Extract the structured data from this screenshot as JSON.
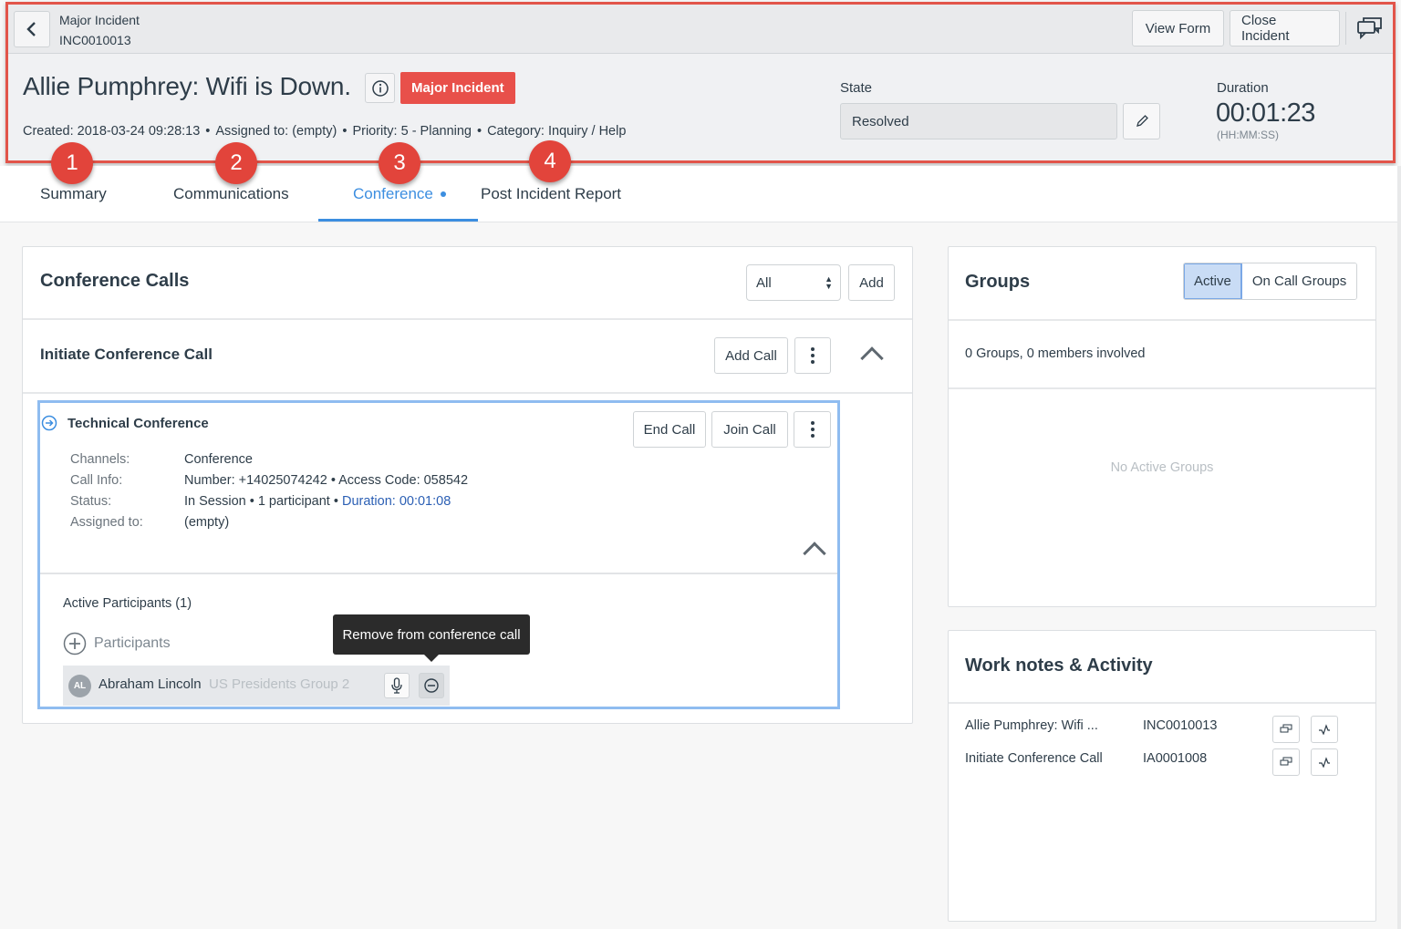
{
  "header": {
    "back_icon": "chevron-left-icon",
    "record_type": "Major Incident",
    "record_number": "INC0010013",
    "view_form_label": "View Form",
    "close_incident_label": "Close Incident",
    "chat_icon": "chat-bubbles-icon",
    "title": "Allie Pumphrey: Wifi is Down.",
    "info_icon": "info-circle-icon",
    "badge": "Major Incident",
    "meta": {
      "created": "Created: 2018-03-24 09:28:13",
      "assigned": "Assigned to: (empty)",
      "priority": "Priority: 5 - Planning",
      "category": "Category: Inquiry / Help",
      "separator": "•"
    },
    "state": {
      "label": "State",
      "value": "Resolved",
      "edit_icon": "pencil-icon"
    },
    "duration": {
      "label": "Duration",
      "value": "00:01:23",
      "unit": "(HH:MM:SS)"
    },
    "accent_color": "#e2554a"
  },
  "tabs": [
    {
      "label": "Summary",
      "active": false
    },
    {
      "label": "Communications",
      "active": false
    },
    {
      "label": "Conference",
      "active": true,
      "has_dot": true
    },
    {
      "label": "Post Incident Report",
      "active": false
    }
  ],
  "markers": [
    "1",
    "2",
    "3",
    "4"
  ],
  "conference": {
    "title": "Conference Calls",
    "filter_value": "All",
    "add_label": "Add",
    "initiate": {
      "title": "Initiate Conference Call",
      "add_call_label": "Add Call"
    },
    "call": {
      "title": "Technical Conference",
      "end_call_label": "End Call",
      "join_call_label": "Join Call",
      "fields": [
        {
          "label": "Channels:",
          "value": "Conference"
        },
        {
          "label": "Call Info:",
          "value": "Number: +14025074242  • Access Code: 058542"
        },
        {
          "label": "Status:",
          "value": "In Session • 1 participant • ",
          "link": "Duration:  00:01:08"
        },
        {
          "label": "Assigned to:",
          "value": "(empty)"
        }
      ],
      "active_participants_label": "Active Participants (1)",
      "add_participants_label": "Participants",
      "participants": [
        {
          "initials": "AL",
          "name": "Abraham Lincoln",
          "group": "US Presidents Group 2"
        }
      ],
      "tooltip": "Remove from conference call"
    }
  },
  "groups": {
    "title": "Groups",
    "toggle": [
      {
        "label": "Active",
        "active": true
      },
      {
        "label": "On Call Groups",
        "active": false
      }
    ],
    "count_text": "0 Groups, 0 members involved",
    "empty_text": "No Active Groups"
  },
  "work_notes": {
    "title": "Work notes & Activity",
    "rows": [
      {
        "name": "Allie Pumphrey: Wifi ...",
        "number": "INC0010013"
      },
      {
        "name": "Initiate Conference Call",
        "number": "IA0001008"
      }
    ]
  }
}
